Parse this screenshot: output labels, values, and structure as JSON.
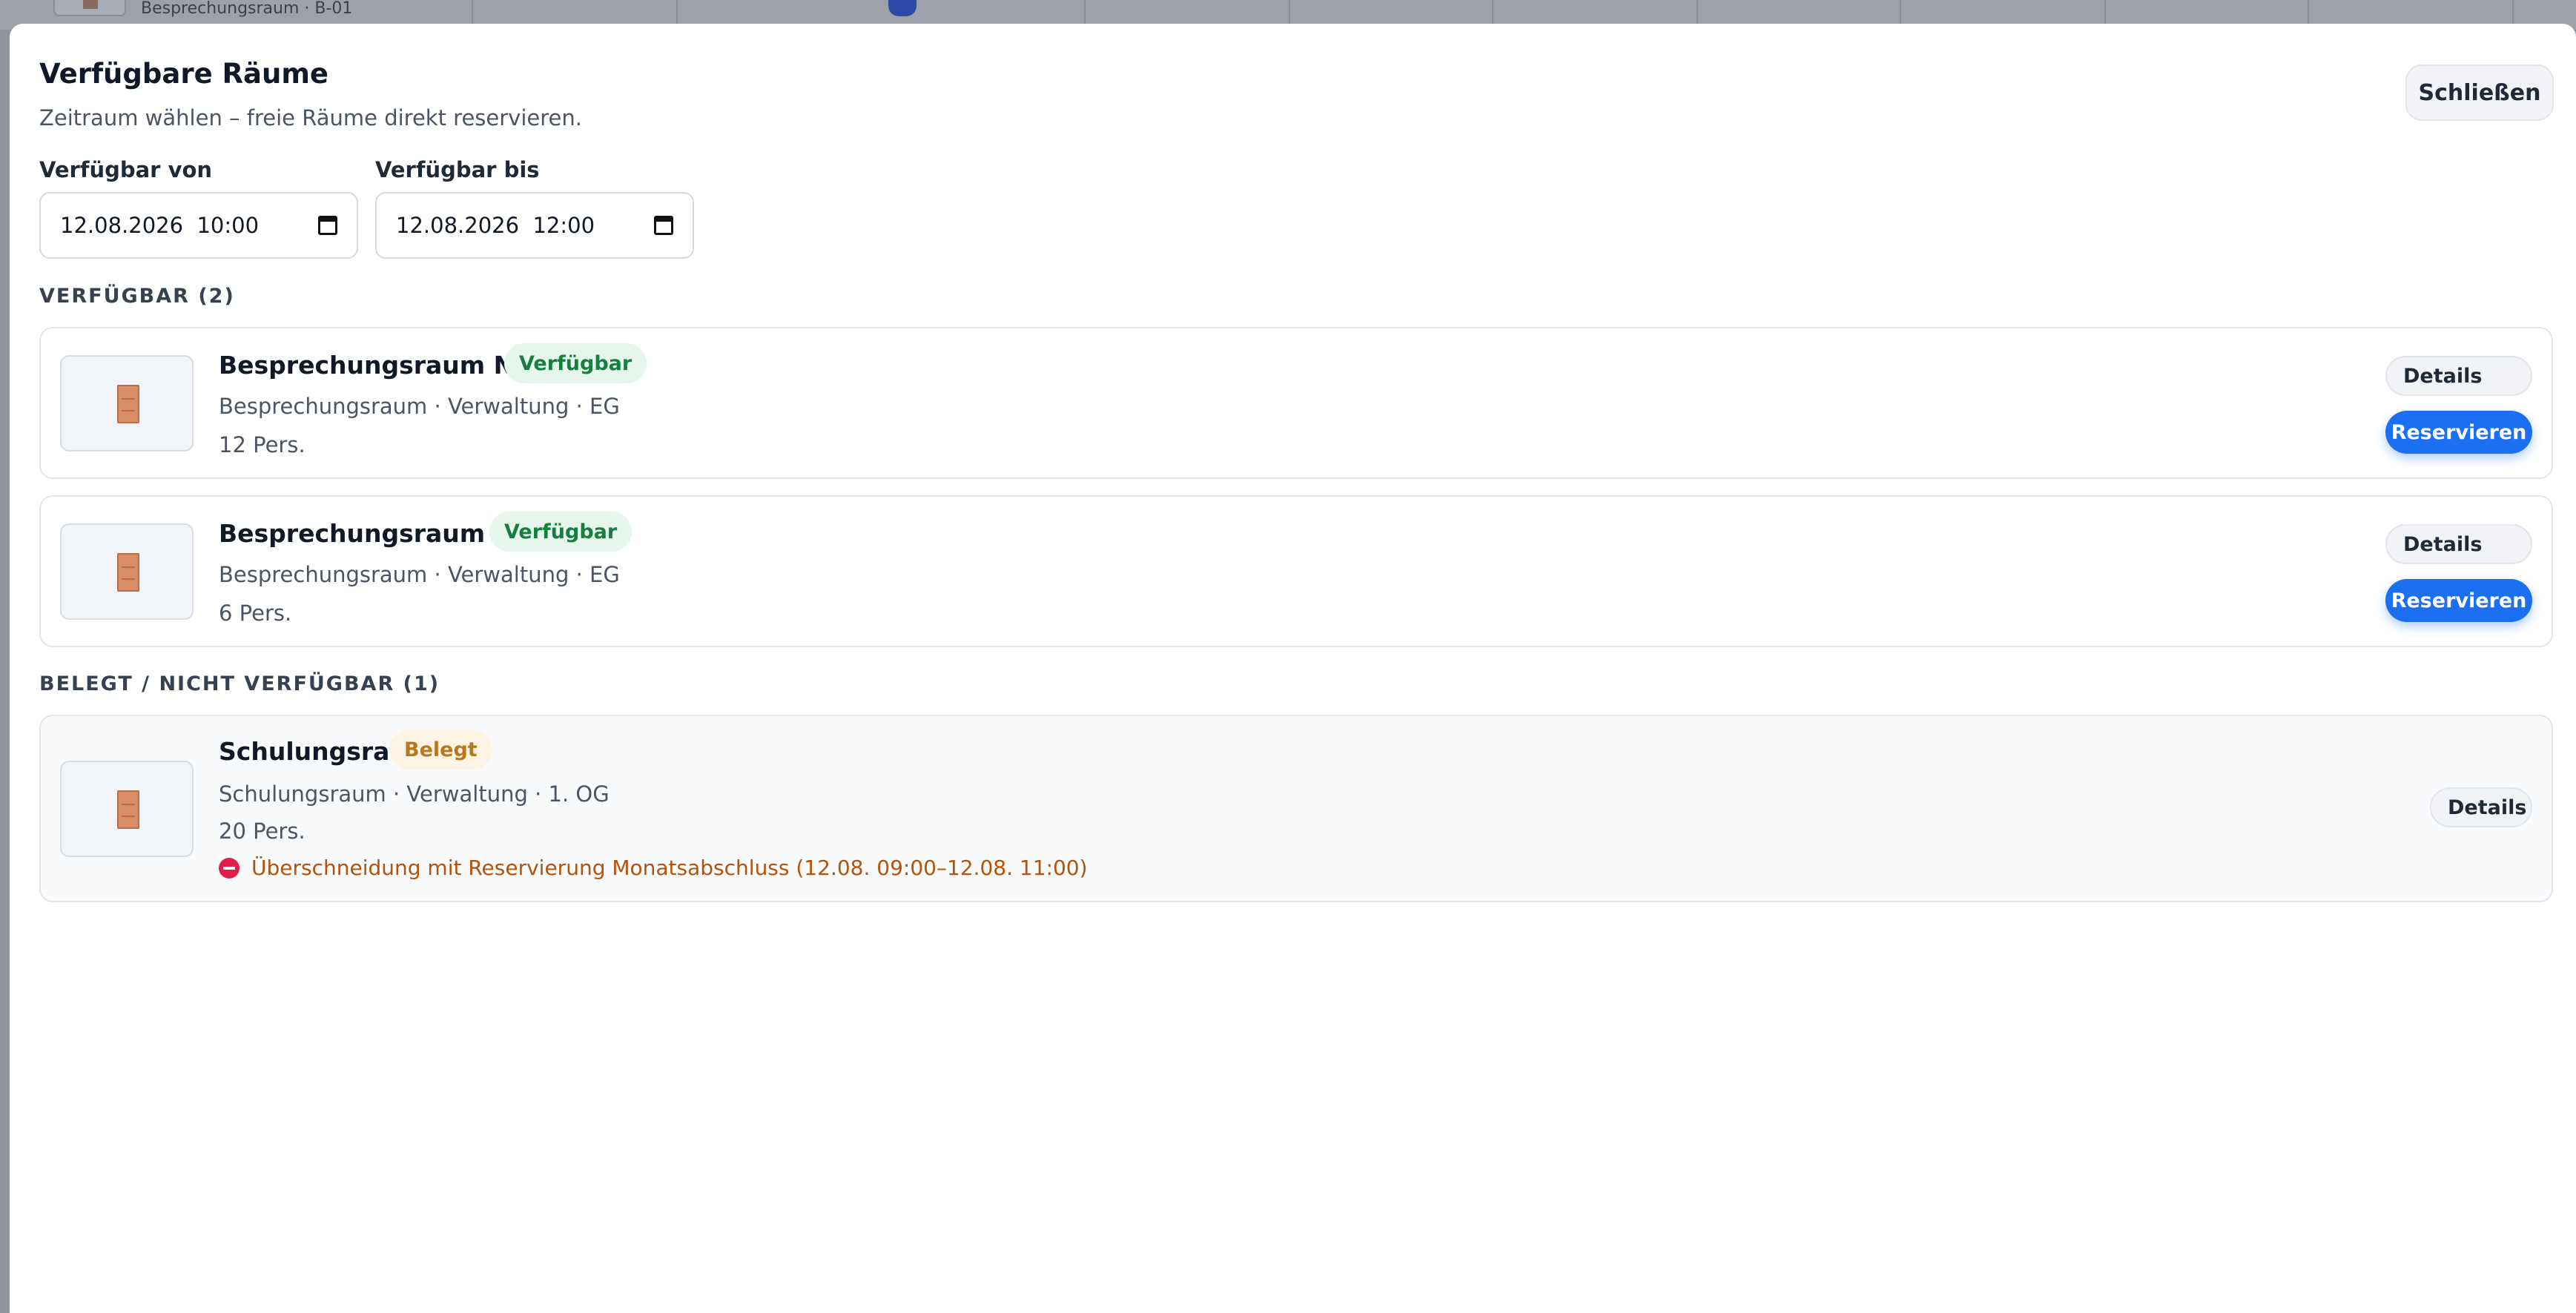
{
  "background": {
    "row_text": "Besprechungsraum · B-01"
  },
  "modal": {
    "title": "Verfügbare Räume",
    "subtitle": "Zeitraum wählen – freie Räume direkt reservieren.",
    "close_label": "Schließen",
    "from_label": "Verfügbar von",
    "from_value": "12.08.2026  10:00",
    "to_label": "Verfügbar bis",
    "to_value": "12.08.2026  12:00"
  },
  "available": {
    "heading": "VERFÜGBAR (2)",
    "rooms": [
      {
        "name": "Besprechungsraum Nord",
        "badge": "Verfügbar",
        "meta": "Besprechungsraum · Verwaltung · EG",
        "capacity": "12 Pers.",
        "details_label": "Details",
        "reserve_label": "Reservieren"
      },
      {
        "name": "Besprechungsraum Süd",
        "badge": "Verfügbar",
        "meta": "Besprechungsraum · Verwaltung · EG",
        "capacity": "6 Pers.",
        "details_label": "Details",
        "reserve_label": "Reservieren"
      }
    ]
  },
  "unavailable": {
    "heading": "BELEGT / NICHT VERFÜGBAR (1)",
    "rooms": [
      {
        "name": "Schulungsraum",
        "badge": "Belegt",
        "meta": "Schulungsraum · Verwaltung · 1. OG",
        "capacity": "20 Pers.",
        "conflict": "Überschneidung mit Reservierung Monatsabschluss (12.08. 09:00–12.08. 11:00)",
        "details_label": "Details"
      }
    ]
  },
  "colors": {
    "accent": "#1d6ff2",
    "available_badge": "#15803d",
    "busy_badge": "#b7791f",
    "conflict_text": "#b45309",
    "conflict_icon": "#e11d48"
  }
}
